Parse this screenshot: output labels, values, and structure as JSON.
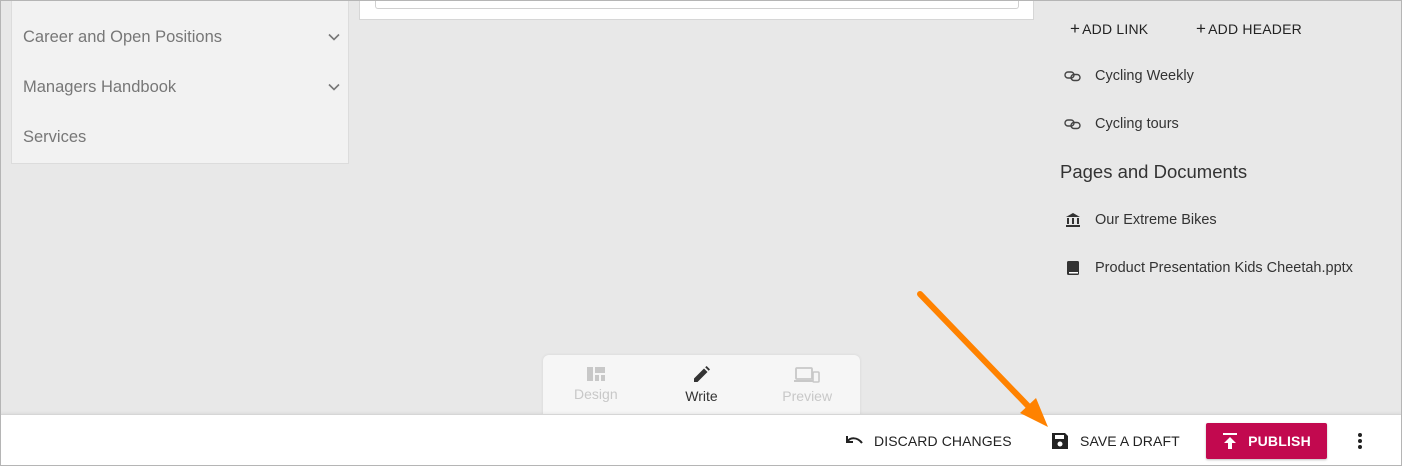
{
  "nav": {
    "items": [
      {
        "label": "Career and Open Positions",
        "has_chevron": true
      },
      {
        "label": "Managers Handbook",
        "has_chevron": true
      },
      {
        "label": "Services",
        "has_chevron": false
      }
    ]
  },
  "right_panel": {
    "add_link_label": "ADD LINK",
    "add_header_label": "ADD HEADER",
    "links": [
      {
        "label": "Cycling Weekly",
        "icon": "link-icon"
      },
      {
        "label": "Cycling tours",
        "icon": "link-icon"
      }
    ],
    "section_title": "Pages and Documents",
    "documents": [
      {
        "label": "Our Extreme Bikes",
        "icon": "bank-icon"
      },
      {
        "label": "Product Presentation Kids Cheetah.pptx",
        "icon": "book-icon"
      }
    ]
  },
  "mode_bar": {
    "modes": [
      {
        "label": "Design",
        "icon": "dashboard-icon",
        "active": false
      },
      {
        "label": "Write",
        "icon": "pencil-icon",
        "active": true
      },
      {
        "label": "Preview",
        "icon": "devices-icon",
        "active": false
      }
    ]
  },
  "actions": {
    "discard_label": "DISCARD CHANGES",
    "save_draft_label": "SAVE A DRAFT",
    "publish_label": "PUBLISH"
  },
  "colors": {
    "publish": "#c2094f",
    "annotation_arrow": "#ff8200",
    "background": "#e8e8e8"
  }
}
